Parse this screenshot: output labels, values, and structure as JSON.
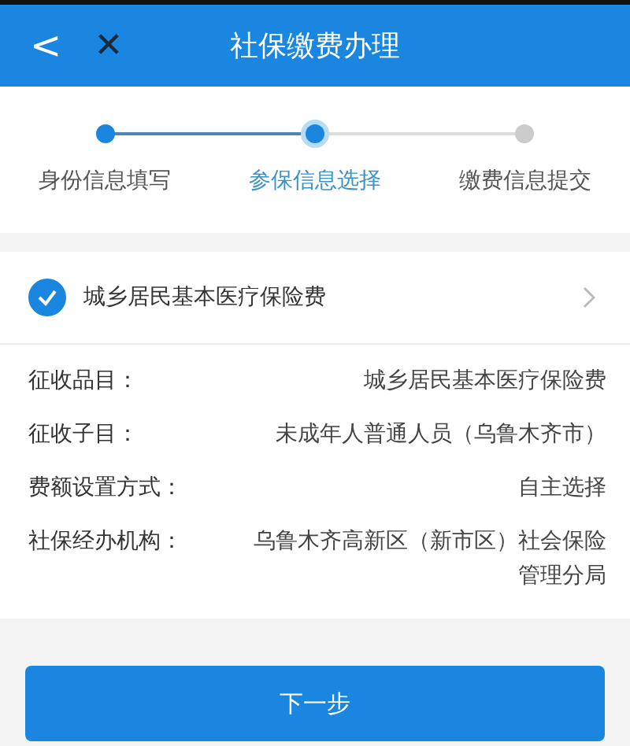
{
  "header": {
    "back": "<",
    "close": "✕",
    "title": "社保缴费办理"
  },
  "steps": [
    {
      "label": "身份信息填写",
      "done": true,
      "selected": false
    },
    {
      "label": "参保信息选择",
      "done": true,
      "selected": true
    },
    {
      "label": "缴费信息提交",
      "done": false,
      "selected": false
    }
  ],
  "insurance": {
    "label": "城乡居民基本医疗保险费",
    "checked": true
  },
  "details": [
    {
      "label": "征收品目：",
      "value": "城乡居民基本医疗保险费"
    },
    {
      "label": "征收子目：",
      "value": "未成年人普通人员（乌鲁木齐市）"
    },
    {
      "label": "费额设置方式：",
      "value": "自主选择"
    },
    {
      "label": "社保经办机构：",
      "value": "乌鲁木齐高新区（新市区）社会保险管理分局"
    }
  ],
  "next_button": "下一步"
}
